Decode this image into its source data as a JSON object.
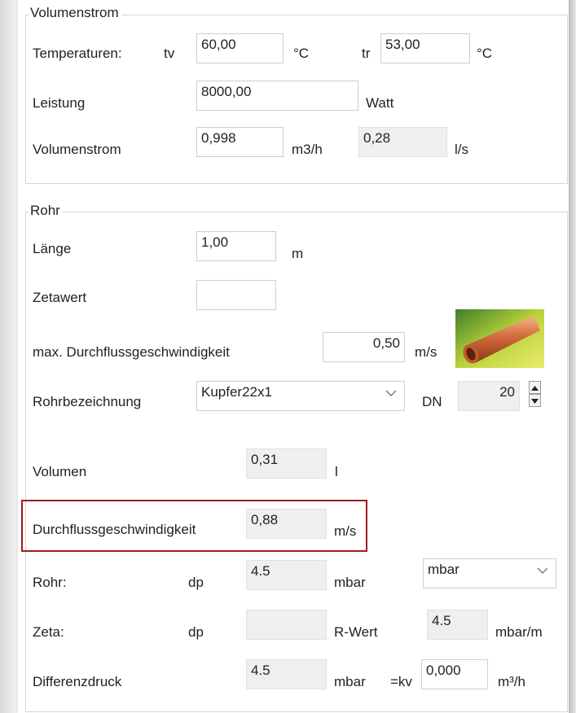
{
  "volumenstrom": {
    "title": "Volumenstrom",
    "temperaturen_label": "Temperaturen:",
    "tv_label": "tv",
    "tv_value": "60,00",
    "tv_unit": "°C",
    "tr_label": "tr",
    "tr_value": "53,00",
    "tr_unit": "°C",
    "leistung_label": "Leistung",
    "leistung_value": "8000,00",
    "leistung_unit": "Watt",
    "vol_label": "Volumenstrom",
    "vol_value": "0,998",
    "vol_unit": "m3/h",
    "vol_ls_value": "0,28",
    "vol_ls_unit": "l/s"
  },
  "rohr": {
    "title": "Rohr",
    "laenge_label": "Länge",
    "laenge_value": "1,00",
    "laenge_unit": "m",
    "zeta_label": "Zetawert",
    "zeta_value": "",
    "maxv_label": "max. Durchflussgeschwindigkeit",
    "maxv_value": "0,50",
    "maxv_unit": "m/s",
    "bez_label": "Rohrbezeichnung",
    "bez_value": "Kupfer22x1",
    "dn_label": "DN",
    "dn_value": "20",
    "pipe_image": "copper-pipe-icon"
  },
  "results": {
    "volumen_label": "Volumen",
    "volumen_value": "0,31",
    "volumen_unit": "l",
    "v_label": "Durchflussgeschwindigkeit",
    "v_value": "0,88",
    "v_unit": "m/s",
    "rohr_label": "Rohr:",
    "rohr_dp_label": "dp",
    "rohr_dp_value": "4.5",
    "rohr_dp_unit": "mbar",
    "unit_select": "mbar",
    "zeta_label": "Zeta:",
    "zeta_dp_label": "dp",
    "zeta_dp_value": "",
    "rwert_label": "R-Wert",
    "rwert_value": "4.5",
    "rwert_unit": "mbar/m",
    "diff_label": "Differenzdruck",
    "diff_value": "4.5",
    "diff_unit": "mbar",
    "kv_label": "=kv",
    "kv_value": "0,000",
    "kv_unit": "m³/h"
  },
  "colors": {
    "highlight": "#a01c1c",
    "readonly_bg": "#efefef"
  }
}
